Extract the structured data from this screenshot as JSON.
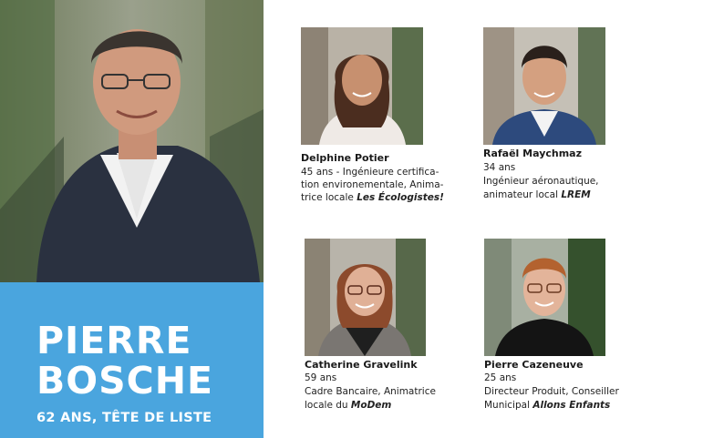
{
  "lead": {
    "name_line1": "PIERRE",
    "name_line2": "BOSCHE",
    "subtitle": "62 ANS, TÊTE DE LISTE"
  },
  "candidates": [
    {
      "name": "Delphine Potier",
      "lines": [
        "45 ans - Ingénieure certifica-",
        "tion environementale, Anima-"
      ],
      "last_line_prefix": "trice locale ",
      "party": "Les Écologistes!"
    },
    {
      "name": "Rafaël Maychmaz",
      "lines": [
        "34 ans",
        "Ingénieur aéronautique,"
      ],
      "last_line_prefix": "animateur local ",
      "party": "LREM"
    },
    {
      "name": "Catherine Gravelink",
      "lines": [
        "59 ans",
        "Cadre Bancaire, Animatrice"
      ],
      "last_line_prefix": "locale du ",
      "party": "MoDem"
    },
    {
      "name": "Pierre Cazeneuve",
      "lines": [
        "25 ans",
        "Directeur Produit, Conseiller"
      ],
      "last_line_prefix": "Municipal ",
      "party": "Allons Enfants"
    }
  ],
  "colors": {
    "accent_blue": "#4aa5de",
    "text": "#1f1f1f"
  }
}
